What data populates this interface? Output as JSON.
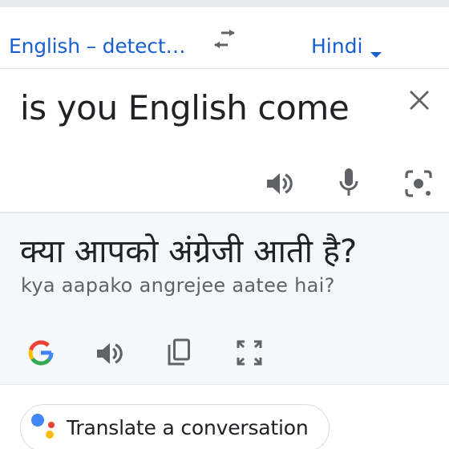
{
  "language_bar": {
    "source_language": "English – detect…",
    "target_language": "Hindi"
  },
  "source": {
    "input_text": "is you English come"
  },
  "result": {
    "translation": "क्या आपको अंग्रेजी आती है?",
    "transliteration": "kya aapako angrejee aatee hai?"
  },
  "conversation_chip": {
    "label": "Translate a conversation"
  },
  "icons": {
    "swap": "swap-languages-icon",
    "clear": "close-icon",
    "source_speaker": "speaker-icon",
    "microphone": "microphone-icon",
    "camera": "lens-camera-icon",
    "google_logo": "google-g-icon",
    "result_speaker": "speaker-icon",
    "copy": "copy-icon",
    "fullscreen": "fullscreen-icon",
    "assistant": "google-assistant-icon"
  },
  "colors": {
    "accent": "#1a5fd1",
    "text_primary": "#202124",
    "text_secondary": "#5f6368",
    "icon_gray": "#5f6368",
    "result_background": "#f5f7fb"
  }
}
